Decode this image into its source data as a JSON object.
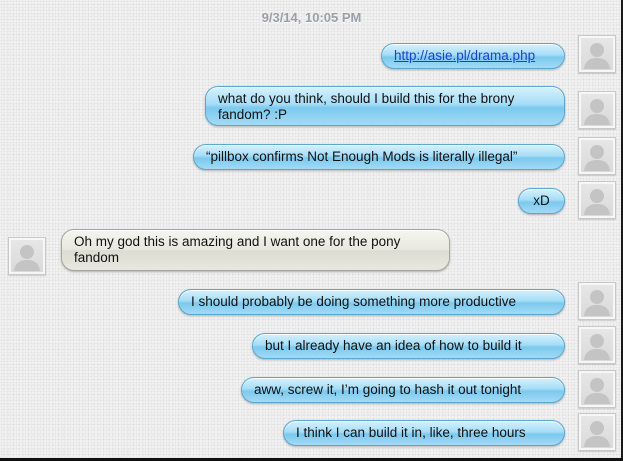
{
  "thread": {
    "timestamp": "9/3/14, 10:05 PM",
    "messages": [
      {
        "side": "out",
        "text": "http://asie.pl/drama.php",
        "is_link": true
      },
      {
        "side": "out",
        "text": "what do you think, should I build this for the brony fandom? :P"
      },
      {
        "side": "out",
        "text": "“pillbox confirms Not Enough Mods is literally illegal”"
      },
      {
        "side": "out",
        "text": "xD"
      },
      {
        "side": "in",
        "text": "Oh my god this is amazing and I want one for the pony fandom"
      },
      {
        "side": "out",
        "text": "I should probably be doing something more productive"
      },
      {
        "side": "out",
        "text": "but I already have an idea of how to build it"
      },
      {
        "side": "out",
        "text": "aww, screw it, I’m going to hash it out tonight"
      },
      {
        "side": "out",
        "text": "I think I can build it in, like, three hours"
      }
    ]
  },
  "colors": {
    "outgoing_bubble": "#a6ddf7",
    "incoming_bubble": "#e7e7de",
    "link": "#1f3fcf",
    "timestamp": "#9a9fa6"
  },
  "icons": {
    "avatar": "default-person-avatar-icon"
  }
}
